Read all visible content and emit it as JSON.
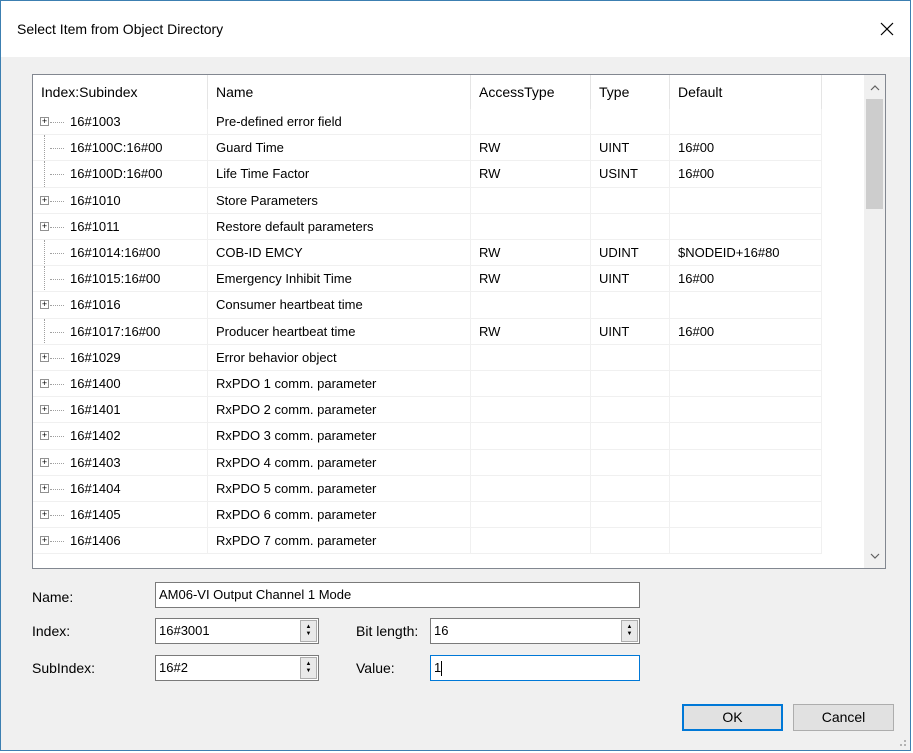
{
  "dialog": {
    "title": "Select Item from Object Directory",
    "close_glyph": "✕"
  },
  "grid": {
    "columns": [
      "Index:Subindex",
      "Name",
      "AccessType",
      "Type",
      "Default"
    ],
    "rows": [
      {
        "index": "16#1003",
        "name": "Pre-defined error field",
        "access": "",
        "type": "",
        "default": "",
        "expandable": true
      },
      {
        "index": "16#100C:16#00",
        "name": "Guard Time",
        "access": "RW",
        "type": "UINT",
        "default": "16#00",
        "expandable": false
      },
      {
        "index": "16#100D:16#00",
        "name": "Life Time Factor",
        "access": "RW",
        "type": "USINT",
        "default": "16#00",
        "expandable": false
      },
      {
        "index": "16#1010",
        "name": "Store Parameters",
        "access": "",
        "type": "",
        "default": "",
        "expandable": true
      },
      {
        "index": "16#1011",
        "name": "Restore default parameters",
        "access": "",
        "type": "",
        "default": "",
        "expandable": true
      },
      {
        "index": "16#1014:16#00",
        "name": "COB-ID EMCY",
        "access": "RW",
        "type": "UDINT",
        "default": "$NODEID+16#80",
        "expandable": false
      },
      {
        "index": "16#1015:16#00",
        "name": "Emergency Inhibit Time",
        "access": "RW",
        "type": "UINT",
        "default": "16#00",
        "expandable": false
      },
      {
        "index": "16#1016",
        "name": "Consumer heartbeat time",
        "access": "",
        "type": "",
        "default": "",
        "expandable": true
      },
      {
        "index": "16#1017:16#00",
        "name": "Producer heartbeat time",
        "access": "RW",
        "type": "UINT",
        "default": "16#00",
        "expandable": false
      },
      {
        "index": "16#1029",
        "name": "Error behavior object",
        "access": "",
        "type": "",
        "default": "",
        "expandable": true
      },
      {
        "index": "16#1400",
        "name": "RxPDO 1 comm. parameter",
        "access": "",
        "type": "",
        "default": "",
        "expandable": true
      },
      {
        "index": "16#1401",
        "name": "RxPDO 2 comm. parameter",
        "access": "",
        "type": "",
        "default": "",
        "expandable": true
      },
      {
        "index": "16#1402",
        "name": "RxPDO 3 comm. parameter",
        "access": "",
        "type": "",
        "default": "",
        "expandable": true
      },
      {
        "index": "16#1403",
        "name": "RxPDO 4 comm. parameter",
        "access": "",
        "type": "",
        "default": "",
        "expandable": true
      },
      {
        "index": "16#1404",
        "name": "RxPDO 5 comm. parameter",
        "access": "",
        "type": "",
        "default": "",
        "expandable": true
      },
      {
        "index": "16#1405",
        "name": "RxPDO 6 comm. parameter",
        "access": "",
        "type": "",
        "default": "",
        "expandable": true
      },
      {
        "index": "16#1406",
        "name": "RxPDO 7 comm. parameter",
        "access": "",
        "type": "",
        "default": "",
        "expandable": true
      }
    ]
  },
  "form": {
    "name_label": "Name:",
    "name_value": "AM06-VI Output Channel 1 Mode",
    "index_label": "Index:",
    "index_value": "16#3001",
    "bitlength_label": "Bit length:",
    "bitlength_value": "16",
    "subindex_label": "SubIndex:",
    "subindex_value": "16#2",
    "value_label": "Value:",
    "value_value": "1"
  },
  "buttons": {
    "ok": "OK",
    "cancel": "Cancel"
  },
  "colors": {
    "accent": "#0078d7",
    "window_border": "#3c7fb1",
    "dialog_bg": "#f0f0f0"
  }
}
